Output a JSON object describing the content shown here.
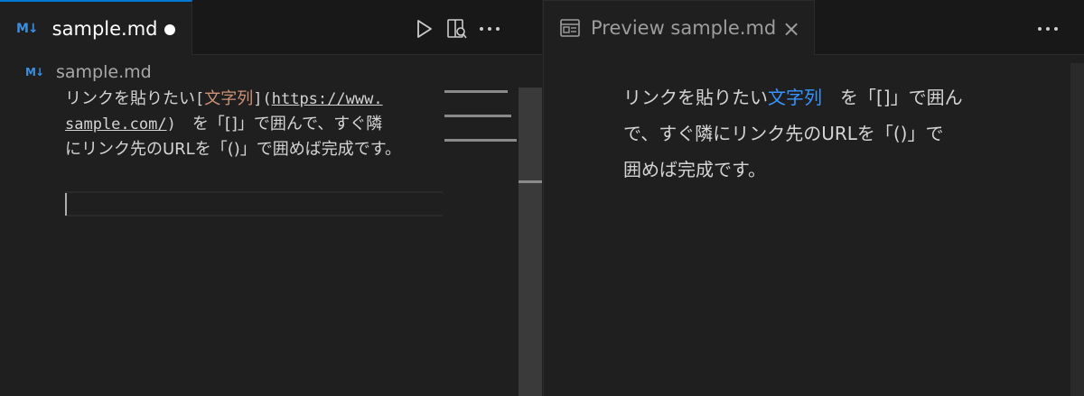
{
  "editor": {
    "tab": {
      "icon": "markdown-icon",
      "icon_text": "M↓",
      "label": "sample.md"
    },
    "breadcrumb": {
      "icon_text": "M↓",
      "label": "sample.md"
    },
    "code": {
      "line1_prefix": "リンクを貼りたい",
      "line1_bracket_open": "[",
      "line1_link_text": "文字列",
      "line1_bracket_close": "](",
      "line1_url": "https://www.",
      "line2_url": "sample.com/",
      "line2_paren_close": ")",
      "line2_rest": "　を「[]」で囲んで、すぐ隣",
      "line3": "にリンク先のURLを「()」で囲めば完成です。"
    }
  },
  "preview": {
    "tab": {
      "icon": "preview-icon",
      "label": "Preview sample.md",
      "close": "×"
    },
    "line1_prefix": "リンクを貼りたい",
    "link_text": "文字列",
    "line1_suffix": "　を「[]」で囲ん",
    "line2": "で、すぐ隣にリンク先のURLを「()」で",
    "line3": "囲めば完成です。"
  },
  "colors": {
    "accent": "#0078d4",
    "link_source": "#ce9178",
    "link_preview": "#3794ff",
    "bg": "#1f1f1f"
  }
}
